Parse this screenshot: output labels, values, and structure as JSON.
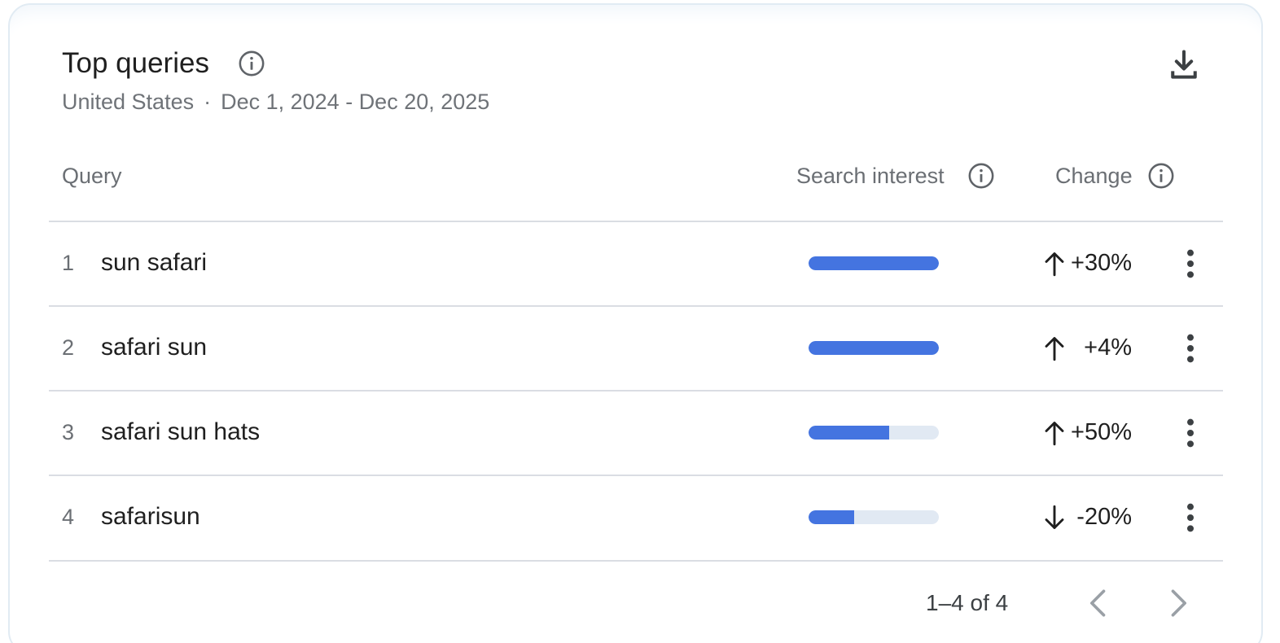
{
  "card": {
    "title": "Top queries",
    "region": "United States",
    "separator": "·",
    "date_range": "Dec 1, 2024 - Dec 20, 2025",
    "title_icon": "info-icon",
    "download_icon": "download-icon"
  },
  "table": {
    "columns": {
      "query": "Query",
      "search_interest": "Search interest",
      "change": "Change"
    },
    "rows": [
      {
        "rank": "1",
        "query": "sun safari",
        "interest": 1.0,
        "direction": "up",
        "change": "+30%"
      },
      {
        "rank": "2",
        "query": "safari sun",
        "interest": 1.0,
        "direction": "up",
        "change": "+4%"
      },
      {
        "rank": "3",
        "query": "safari sun hats",
        "interest": 0.62,
        "direction": "up",
        "change": "+50%"
      },
      {
        "rank": "4",
        "query": "safarisun",
        "interest": 0.35,
        "direction": "down",
        "change": "-20%"
      }
    ]
  },
  "pagination": {
    "label": "1–4 of 4",
    "prev_icon": "chevron-left-icon",
    "next_icon": "chevron-right-icon"
  },
  "colors": {
    "bar_fill": "#4474e0",
    "bar_track": "#e1e9f3",
    "card_border": "#e1ebf3",
    "muted_text": "#6b6f74"
  }
}
